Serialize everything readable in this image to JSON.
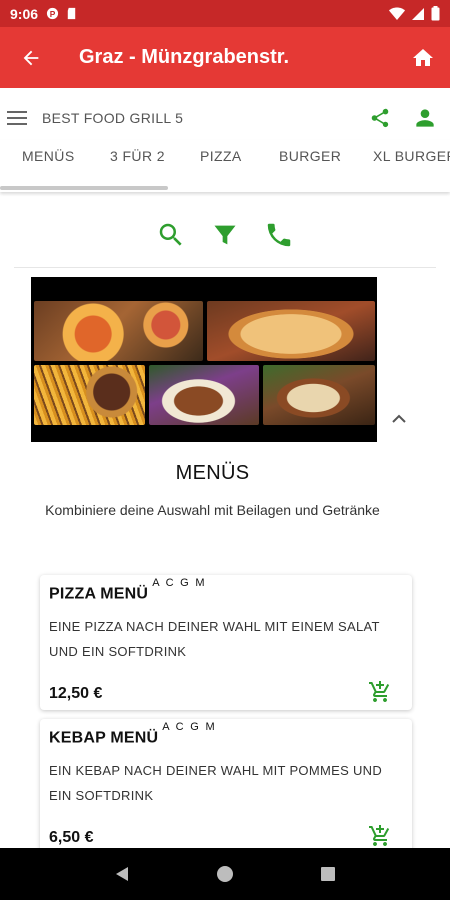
{
  "status_bar": {
    "time": "9:06",
    "icons": [
      "notification-icon",
      "sd-card-icon",
      "wifi-icon",
      "signal-icon",
      "battery-icon"
    ]
  },
  "app_bar": {
    "title": "Graz - Münzgrabenstr.",
    "back_icon": "arrow-back-icon",
    "home_icon": "home-icon",
    "color": "#e53935"
  },
  "store": {
    "name": "BEST FOOD GRILL 5",
    "menu_icon": "hamburger-menu-icon",
    "share_icon": "share-icon",
    "account_icon": "account-icon"
  },
  "categories": [
    "MENÜS",
    "3 FÜR 2",
    "PIZZA",
    "BURGER",
    "XL BURGER"
  ],
  "actions": [
    "search-icon",
    "filter-icon",
    "phone-icon"
  ],
  "section": {
    "title": "MENÜS",
    "subtitle": "Kombiniere deine Auswahl mit Beilagen und Getränke"
  },
  "products": [
    {
      "name": "PIZZA MENÜ",
      "allergens": "A C G M",
      "description": "EINE PIZZA NACH DEINER WAHL MIT EINEM SALAT UND EIN SOFTDRINK",
      "price": "12,50 €"
    },
    {
      "name": "KEBAP MENÜ",
      "allergens": "A C G M",
      "description": "EIN KEBAP NACH DEINER WAHL MIT POMMES UND EIN SOFTDRINK",
      "price": "6,50 €"
    }
  ],
  "accent_color": "#2e9e2e",
  "nav_bar": [
    "back-nav-icon",
    "home-nav-icon",
    "recents-nav-icon"
  ]
}
